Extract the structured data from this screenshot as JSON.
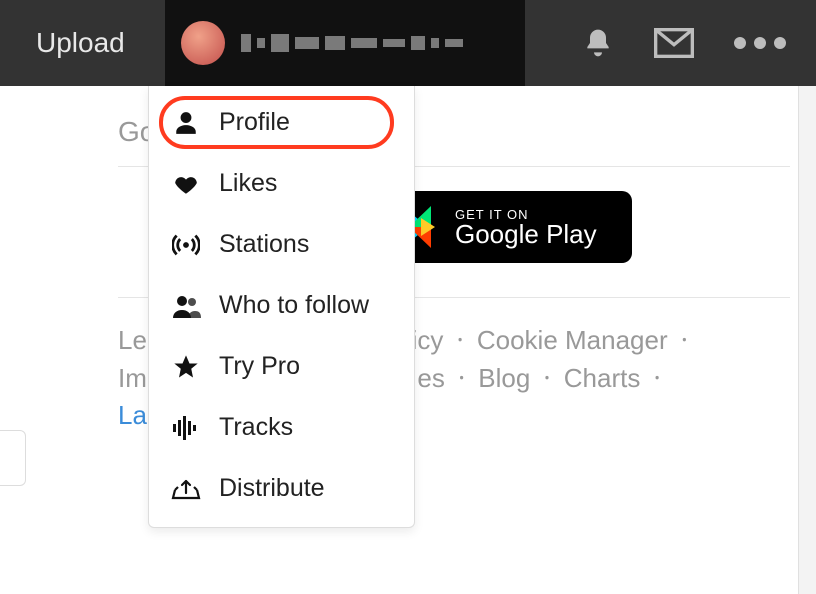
{
  "topbar": {
    "upload_label": "Upload"
  },
  "dropdown": {
    "items": [
      {
        "key": "profile",
        "label": "Profile",
        "highlighted": true
      },
      {
        "key": "likes",
        "label": "Likes"
      },
      {
        "key": "stations",
        "label": "Stations"
      },
      {
        "key": "who-to-follow",
        "label": "Who to follow"
      },
      {
        "key": "try-pro",
        "label": "Try Pro"
      },
      {
        "key": "tracks",
        "label": "Tracks"
      },
      {
        "key": "distribute",
        "label": "Distribute"
      }
    ]
  },
  "content": {
    "go_mobile_heading_visible": "Go",
    "google_badge_top": "GET IT ON",
    "google_badge_bottom": "Google Play"
  },
  "footer": {
    "links_partial": {
      "le": "Le",
      "olicy": "olicy",
      "cookie_manager": "Cookie Manager",
      "im": "Im",
      "es": "es",
      "blog": "Blog",
      "charts": "Charts",
      "la": "La"
    }
  }
}
